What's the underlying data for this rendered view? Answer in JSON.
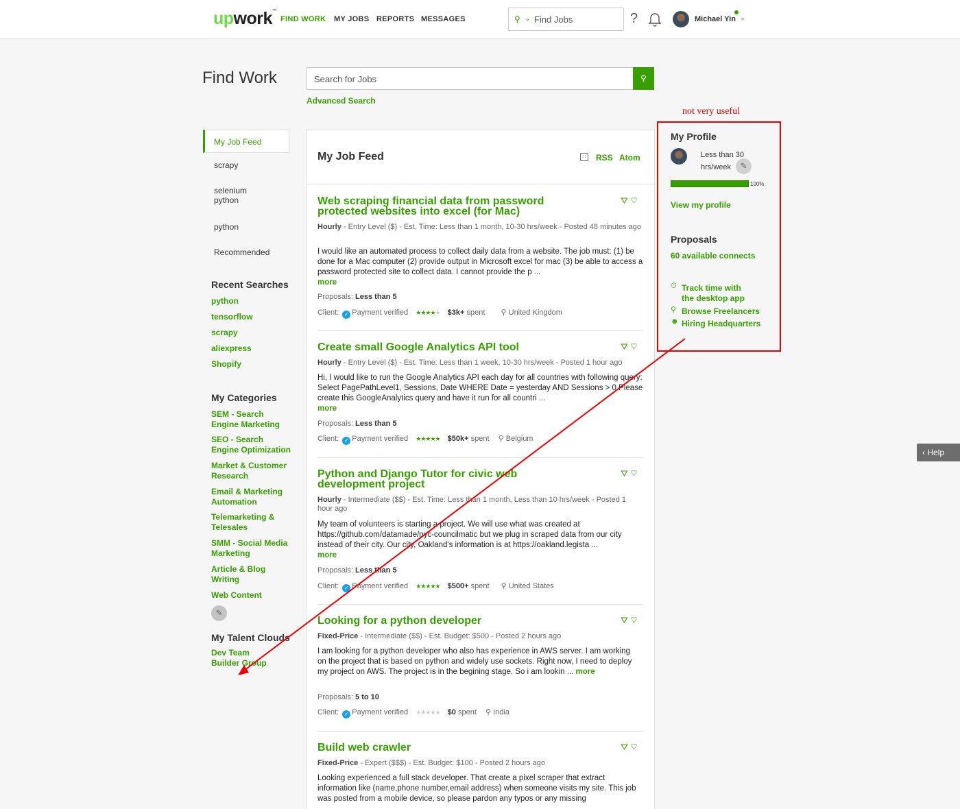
{
  "nav": {
    "logo_up": "up",
    "logo_rest": "work",
    "logo_tm": "™",
    "items": [
      "FIND WORK",
      "MY JOBS",
      "REPORTS",
      "MESSAGES"
    ],
    "search_placeholder": "Find Jobs",
    "help_glyph": "?",
    "user_name": "Michael Yin"
  },
  "page": {
    "title": "Find Work",
    "search_placeholder": "Search for Jobs",
    "advanced_search": "Advanced Search"
  },
  "sidebar": {
    "feeds": [
      "My Job Feed",
      "scrapy",
      "selenium python",
      "python",
      "Recommended"
    ],
    "recent_title": "Recent Searches",
    "recent": [
      "python",
      "tensorflow",
      "scrapy",
      "aliexpress",
      "Shopify"
    ],
    "categories_title": "My Categories",
    "categories": [
      "SEM - Search Engine Marketing",
      "SEO - Search Engine Optimization",
      "Market & Customer Research",
      "Email & Marketing Automation",
      "Telemarketing & Telesales",
      "SMM - Social Media Marketing",
      "Article & Blog Writing",
      "Web Content"
    ],
    "talent_title": "My Talent Clouds",
    "talent": [
      "Dev Team Builder Group"
    ]
  },
  "feed": {
    "title": "My Job Feed",
    "rss": "RSS",
    "atom": "Atom",
    "more_label": "more",
    "proposals_label": "Proposals:",
    "client_label": "Client:",
    "verified_label": "Payment verified",
    "spent_suffix": "spent",
    "jobs": [
      {
        "title": "Web scraping financial data from password protected websites into excel (for Mac)",
        "type": "Hourly",
        "meta": " - Entry Level ($) - Est. Time: Less than 1 month, 10-30 hrs/week - Posted 48 minutes ago",
        "desc": "I would like an automated process to collect daily data from a website. The job must: (1) be done for a Mac computer (2) provide output in Microsoft excel for mac (3) be able to access a password protected site to collect data. I cannot provide the p ...",
        "proposals": "Less than 5",
        "rating": 4,
        "spent": "$3k+",
        "location": "United Kingdom"
      },
      {
        "title": "Create small Google Analytics API tool",
        "type": "Hourly",
        "meta": " - Entry Level ($) - Est. Time: Less than 1 week, 10-30 hrs/week - Posted 1 hour ago",
        "desc": "Hi, I would like to run the Google Analytics API each day for all countries with following query: Select PagePathLevel1, Sessions, Date WHERE Date = yesterday AND Sessions > 0 Please create this GoogleAnalytics query and have it run for all countri ...",
        "proposals": "Less than 5",
        "rating": 5,
        "spent": "$50k+",
        "location": "Belgium"
      },
      {
        "title": "Python and Django Tutor for civic web development project",
        "type": "Hourly",
        "meta": " - Intermediate ($$) - Est. Time: Less than 1 month, Less than 10 hrs/week - Posted 1 hour ago",
        "desc": "My team of volunteers is starting a project. We will use what was created at https://github.com/datamade/nyc-councilmatic but we plug in scraped data from our city instead of their city. Our city, Oakland's information is at https://oakland.legista ...",
        "proposals": "Less than 5",
        "rating": 5,
        "spent": "$500+",
        "location": "United States"
      },
      {
        "title": "Looking for a python developer",
        "type": "Fixed-Price",
        "meta": " - Intermediate ($$) - Est. Budget: $500 - Posted 2 hours ago",
        "desc": "I am looking for a python developer who also has experience in AWS server. I am working on the project that is based on python and widely use sockets. Right now, I need to deploy my project on AWS. The project is in the begining stage. So i am lookin ...",
        "proposals": "5 to 10",
        "rating": 0,
        "spent": "$0",
        "location": "India"
      },
      {
        "title": "Build web crawler",
        "type": "Fixed-Price",
        "meta": " - Expert ($$$) - Est. Budget: $100 - Posted 2 hours ago",
        "desc": "Looking experienced a full stack developer. That create a pixel scraper that extract information like (name,phone number,email address) when someone visits my site. This job was posted from a mobile device, so please pardon any typos or any missing"
      }
    ]
  },
  "right": {
    "profile_title": "My Profile",
    "availability": "Less than 30 hrs/week",
    "completeness_pct": 100,
    "completeness_label": "100%",
    "view_profile": "View my profile",
    "proposals_title": "Proposals",
    "connects": "60 available connects",
    "links": [
      "Track time with the desktop app",
      "Browse Freelancers",
      "Hiring Headquarters"
    ]
  },
  "annotation": {
    "note": "not very useful",
    "color": "#e00000"
  },
  "help": "Help",
  "colors": {
    "brand": "#37a000",
    "annotation": "#e00000"
  }
}
